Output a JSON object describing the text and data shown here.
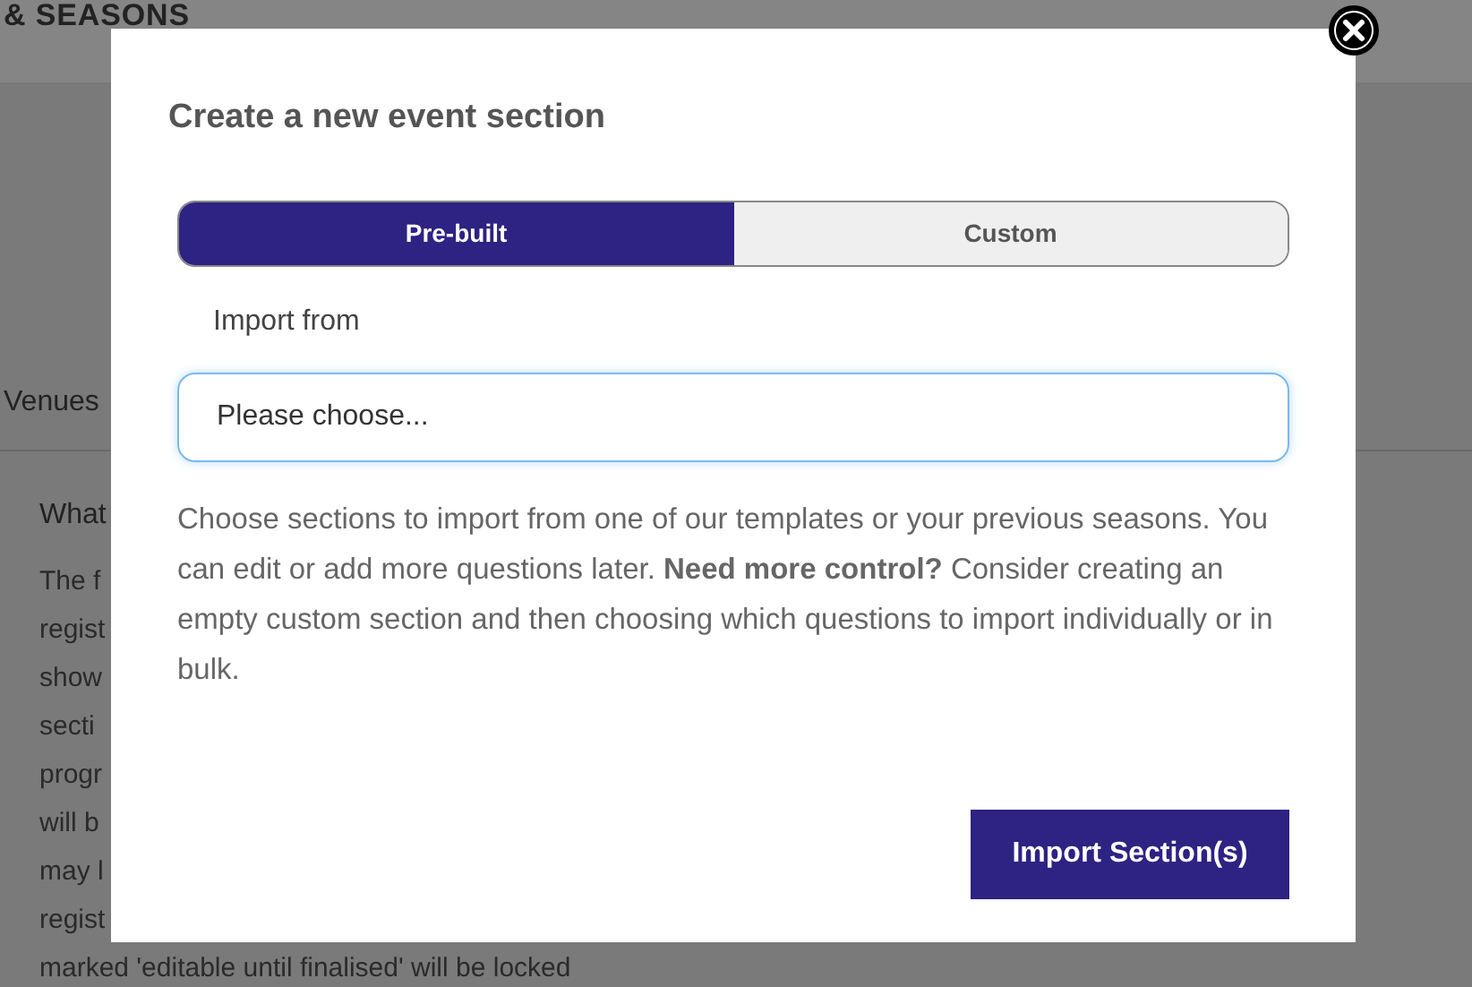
{
  "background_page": {
    "menu_title": "& SEASONS",
    "tabs": [
      "Venues"
    ],
    "heading": "What",
    "paragraph_lines": [
      "The f",
      "regist",
      "show",
      "secti",
      "progr",
      "will b",
      "may l",
      "regist",
      "marked 'editable until finalised' will be locked"
    ]
  },
  "dialog": {
    "title": "Create a new event section",
    "tabs": [
      {
        "label": "Pre-built",
        "selected": true
      },
      {
        "label": "Custom",
        "selected": false
      }
    ],
    "field_label": "Import from",
    "select": {
      "placeholder": "Please choose..."
    },
    "description": "Choose sections to import from one of our templates or your previous seasons. You can edit or add more questions later. **Need more control?** Consider creating an empty custom section and then choosing which questions to import individually or in bulk.",
    "button": "Import Section(s)"
  }
}
